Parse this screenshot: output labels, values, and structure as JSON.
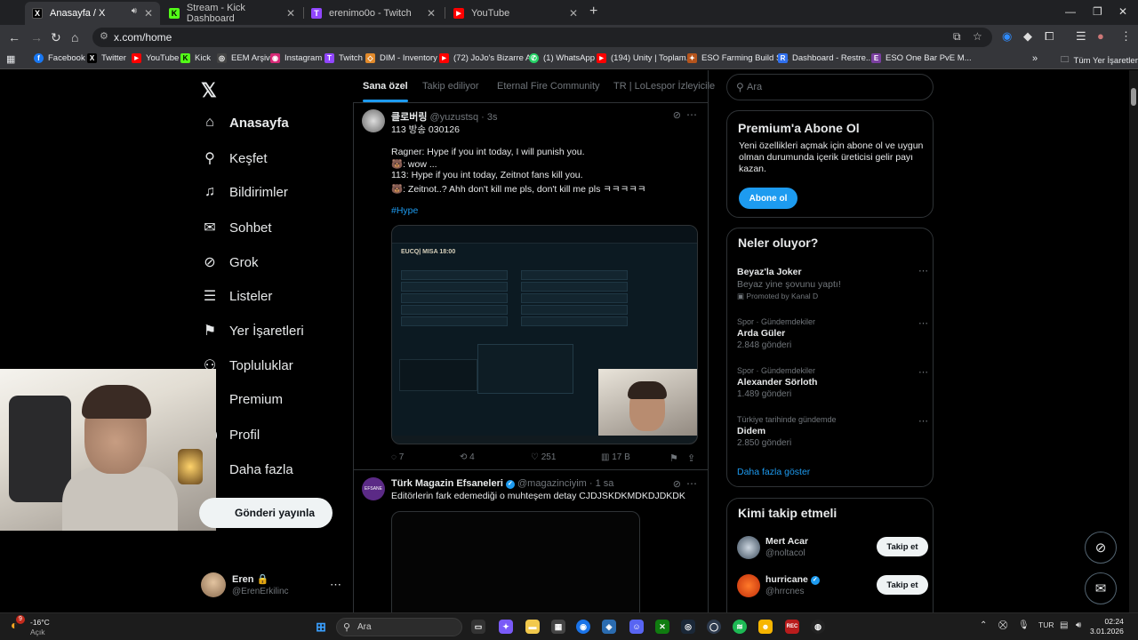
{
  "browser": {
    "tabs": [
      {
        "title": "Anasayfa / X",
        "icon": "x-icon",
        "color": "#000000",
        "glyph": "X"
      },
      {
        "title": "Stream - Kick Dashboard",
        "icon": "kick-icon",
        "color": "#53fc18",
        "glyph": "K"
      },
      {
        "title": "erenimo0o - Twitch",
        "icon": "twitch-icon",
        "color": "#9146ff",
        "glyph": "T"
      },
      {
        "title": "YouTube",
        "icon": "youtube-icon",
        "color": "#ff0000",
        "glyph": "▶"
      }
    ],
    "url": "x.com/home",
    "bookmarks": [
      {
        "label": "Facebook",
        "color": "#1877f2",
        "glyph": "f"
      },
      {
        "label": "Twitter",
        "color": "#000000",
        "glyph": "X"
      },
      {
        "label": "YouTube",
        "color": "#ff0000",
        "glyph": "▶"
      },
      {
        "label": "Kick",
        "color": "#53fc18",
        "glyph": "K"
      },
      {
        "label": "EEM Arşiv",
        "color": "#444444",
        "glyph": "◎"
      },
      {
        "label": "Instagram",
        "color": "#d62976",
        "glyph": "◉"
      },
      {
        "label": "Twitch",
        "color": "#9146ff",
        "glyph": "T"
      },
      {
        "label": "DIM - Inventory",
        "color": "#e28a2b",
        "glyph": "◇"
      },
      {
        "label": "(72) JoJo's Bizarre A...",
        "color": "#ff0000",
        "glyph": "▶"
      },
      {
        "label": "(1) WhatsApp",
        "color": "#25d366",
        "glyph": "✆"
      },
      {
        "label": "(194) Unity | Toplam...",
        "color": "#ff0000",
        "glyph": "▶"
      },
      {
        "label": "ESO Farming Build S...",
        "color": "#b5541c",
        "glyph": "✦"
      },
      {
        "label": "Dashboard - Restre...",
        "color": "#2f6fed",
        "glyph": "R"
      },
      {
        "label": "ESO One Bar PvE M...",
        "color": "#7a3fa0",
        "glyph": "E"
      }
    ],
    "all_bookmarks": "Tüm Yer İşaretleri"
  },
  "sidebar": {
    "items": [
      {
        "label": "Anasayfa",
        "icon": "home-icon",
        "glyph": "⌂"
      },
      {
        "label": "Keşfet",
        "icon": "search-icon",
        "glyph": "⚲"
      },
      {
        "label": "Bildirimler",
        "icon": "bell-icon",
        "glyph": "🔔︎"
      },
      {
        "label": "Sohbet",
        "icon": "mail-icon",
        "glyph": "✉"
      },
      {
        "label": "Grok",
        "icon": "grok-icon",
        "glyph": "⊘"
      },
      {
        "label": "Listeler",
        "icon": "list-icon",
        "glyph": "☰"
      },
      {
        "label": "Yer İşaretleri",
        "icon": "bookmark-icon",
        "glyph": "⚑"
      },
      {
        "label": "Topluluklar",
        "icon": "communities-icon",
        "glyph": "⚇"
      },
      {
        "label": "Premium",
        "icon": "x-premium-icon",
        "glyph": "X"
      },
      {
        "label": "Profil",
        "icon": "profile-icon",
        "glyph": "◯"
      },
      {
        "label": "Daha fazla",
        "icon": "more-icon",
        "glyph": "⋯"
      }
    ],
    "post_button": "Gönderi yayınla",
    "profile": {
      "name": "Eren 🔒",
      "handle": "@ErenErkilinc"
    }
  },
  "feed": {
    "tabs": [
      "Sana özel",
      "Takip ediliyor",
      "Eternal Fire Community",
      "TR | LoLespor İzleyicile"
    ],
    "tweet1": {
      "name": "클로버링",
      "handle": "@yuzustsq · 3s",
      "lines": [
        "113 방송 030126",
        "",
        "Ragner: Hype if you int today, I will punish you.",
        "🐻: wow ...",
        "113: Hype if you int today, Zeitnot fans kill you.",
        "🐻: Zeitnot..? Ahh don't kill me pls, don't kill me pls ㅋㅋㅋㅋㅋ"
      ],
      "hashtag": "#Hype",
      "media_lobby": "EUCQ| MISA 18:00",
      "replies": "7",
      "reposts": "4",
      "likes": "251",
      "views": "17 B"
    },
    "tweet2": {
      "name": "Türk Magazin Efsaneleri",
      "handle": "@magazinciyim · 1 sa",
      "text": "Editörlerin fark edemediği o muhteşem detay CJDJSKDKMDKDJDKDK"
    }
  },
  "right": {
    "search_placeholder": "Ara",
    "premium": {
      "title": "Premium'a Abone Ol",
      "text": "Yeni özellikleri açmak için abone ol ve uygun olman durumunda içerik üreticisi gelir payı kazan.",
      "button": "Abone ol"
    },
    "trends_title": "Neler oluyor?",
    "trends": [
      {
        "cat": "",
        "name": "Beyaz'la Joker",
        "sub": "Beyaz yine şovunu yaptı!",
        "extra": "Promoted by Kanal D"
      },
      {
        "cat": "Spor · Gündemdekiler",
        "name": "Arda Güler",
        "sub": "2.848 gönderi",
        "extra": ""
      },
      {
        "cat": "Spor · Gündemdekiler",
        "name": "Alexander Sörloth",
        "sub": "1.489 gönderi",
        "extra": ""
      },
      {
        "cat": "Türkiye tarihinde gündemde",
        "name": "Didem",
        "sub": "2.850 gönderi",
        "extra": ""
      }
    ],
    "show_more": "Daha fazla göster",
    "who_title": "Kimi takip etmeli",
    "who": [
      {
        "name": "Mert Acar",
        "handle": "@noltacol",
        "button": "Takip et"
      },
      {
        "name": "hurricane",
        "handle": "@hrrcnes",
        "button": "Takip et"
      }
    ]
  },
  "taskbar": {
    "temp": "-16°C",
    "weather": "Açık",
    "search": "Ara",
    "lang": "TUR",
    "time": "02:24",
    "date": "3.01.2026"
  }
}
